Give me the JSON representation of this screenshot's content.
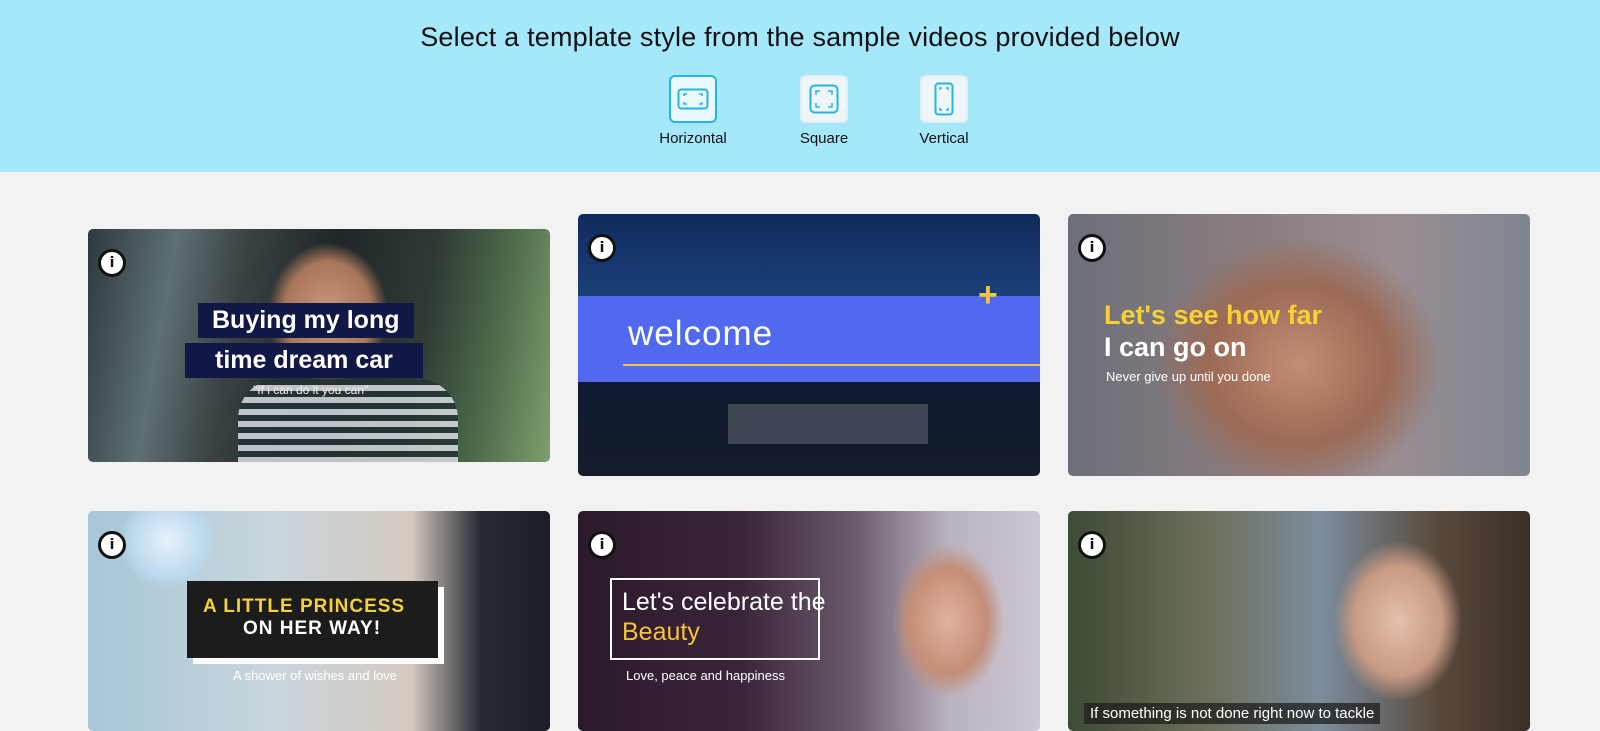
{
  "header": {
    "title": "Select a template style from the sample videos provided below",
    "formats": [
      {
        "label": "Horizontal",
        "icon": "horizontal-frame-icon",
        "selected": true
      },
      {
        "label": "Square",
        "icon": "square-frame-icon",
        "selected": false
      },
      {
        "label": "Vertical",
        "icon": "vertical-frame-icon",
        "selected": false
      }
    ]
  },
  "colors": {
    "header_bg": "#a6e8fb",
    "accent": "#21b6e6",
    "page_bg": "#f2f2f2"
  },
  "templates": [
    {
      "info": "i",
      "line1": "Buying my long",
      "line2": "time dream car",
      "sub": "\"If i can do it you can\""
    },
    {
      "info": "i",
      "title": "welcome",
      "plus": "+"
    },
    {
      "info": "i",
      "line1": "Let's see how far",
      "line2": "I can go on",
      "sub": "Never give up until you done"
    },
    {
      "info": "i",
      "line1": "A LITTLE PRINCESS",
      "line2": "ON HER WAY!",
      "sub": "A shower of wishes and love"
    },
    {
      "info": "i",
      "line1": "Let's celebrate the",
      "line2": "Beauty",
      "sub": "Love, peace and happiness"
    },
    {
      "info": "i",
      "caption": "If something is not done right now to tackle"
    }
  ]
}
